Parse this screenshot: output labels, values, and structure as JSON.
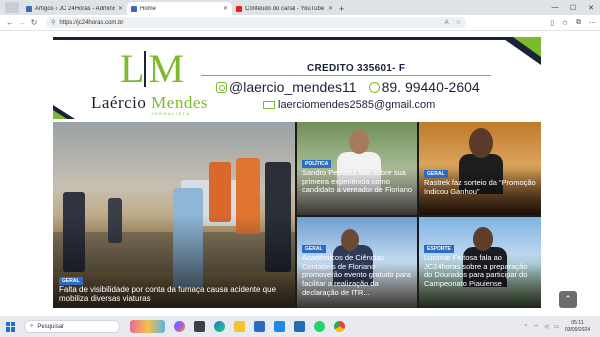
{
  "browser": {
    "tabs": [
      {
        "title": "Artigos ‹ JC 24Horas - Administração",
        "favicon_color": "#3c6bb0",
        "active": false
      },
      {
        "title": "Home",
        "favicon_color": "#3c6bb0",
        "active": true
      },
      {
        "title": "Conteúdo do canal - YouTube Studio",
        "favicon_color": "#e62117",
        "active": false
      }
    ],
    "new_tab_label": "+",
    "url": "https://jc24horas.com.br"
  },
  "banner": {
    "logo_initials_l": "L",
    "logo_initials_m": "M",
    "logo_name_first": "Laércio",
    "logo_name_last": "Mendes",
    "logo_subtitle": "JORNALISTA",
    "credit": "CREDITO 335601- F",
    "instagram": "@laercio_mendes11",
    "whatsapp": "89. 99440-2604",
    "email": "laerciomendes2585@gmail.com",
    "accent_color": "#7dbb2e",
    "brand_color": "#1a2238"
  },
  "news": {
    "main": {
      "tag": "GERAL",
      "headline": "Falta de visibilidade por conta da fumaça causa acidente que mobiliza diversas viaturas"
    },
    "items": [
      {
        "tag": "POLÍTICA",
        "headline": "Sandro Petrarca fala sobre sua primeira experiência como candidato a vereador de Floriano"
      },
      {
        "tag": "GERAL",
        "headline": "Rastrek faz sorteio da “Promoção Indicou Ganhou”"
      },
      {
        "tag": "GERAL",
        "headline": "Acadêmicos de Ciências Contábeis de Floriano promoverão evento gratuito para facilitar a realização da declaração de ITR..."
      },
      {
        "tag": "ESPORTE",
        "headline": "Lucimar Feitosa fala ao JC24horas sobre a preparação do Dourados para participar do Campeonato Piauiense"
      }
    ],
    "tag_color": "#2b6cc4"
  },
  "taskbar": {
    "search_placeholder": "Pesquisar",
    "time": "05:11",
    "date": "03/09/2024"
  }
}
